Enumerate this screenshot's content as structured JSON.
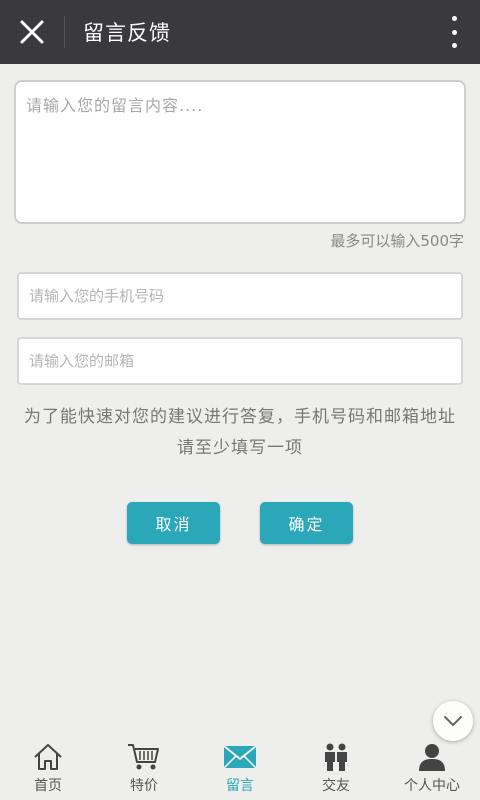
{
  "header": {
    "title": "留言反馈",
    "close_icon": "close-icon",
    "menu_icon": "more-vertical-icon"
  },
  "form": {
    "message_placeholder": "请输入您的留言内容....",
    "message_value": "",
    "limit_hint": "最多可以输入500字",
    "phone_placeholder": "请输入您的手机号码",
    "phone_value": "",
    "email_placeholder": "请输入您的邮箱",
    "email_value": "",
    "notice_line1": "为了能快速对您的建议进行答复，手机号码和邮箱地址",
    "notice_line2": "请至少填写一项",
    "cancel_label": "取消",
    "confirm_label": "确定"
  },
  "tabbar": {
    "items": [
      {
        "label": "首页",
        "icon": "home-icon",
        "active": false
      },
      {
        "label": "特价",
        "icon": "cart-icon",
        "active": false
      },
      {
        "label": "留言",
        "icon": "mail-icon",
        "active": true
      },
      {
        "label": "交友",
        "icon": "people-icon",
        "active": false
      },
      {
        "label": "个人中心",
        "icon": "user-icon",
        "active": false
      }
    ]
  },
  "colors": {
    "header_bg": "#3a3a3c",
    "accent": "#2aa7b8",
    "page_bg": "#eeeeec"
  }
}
